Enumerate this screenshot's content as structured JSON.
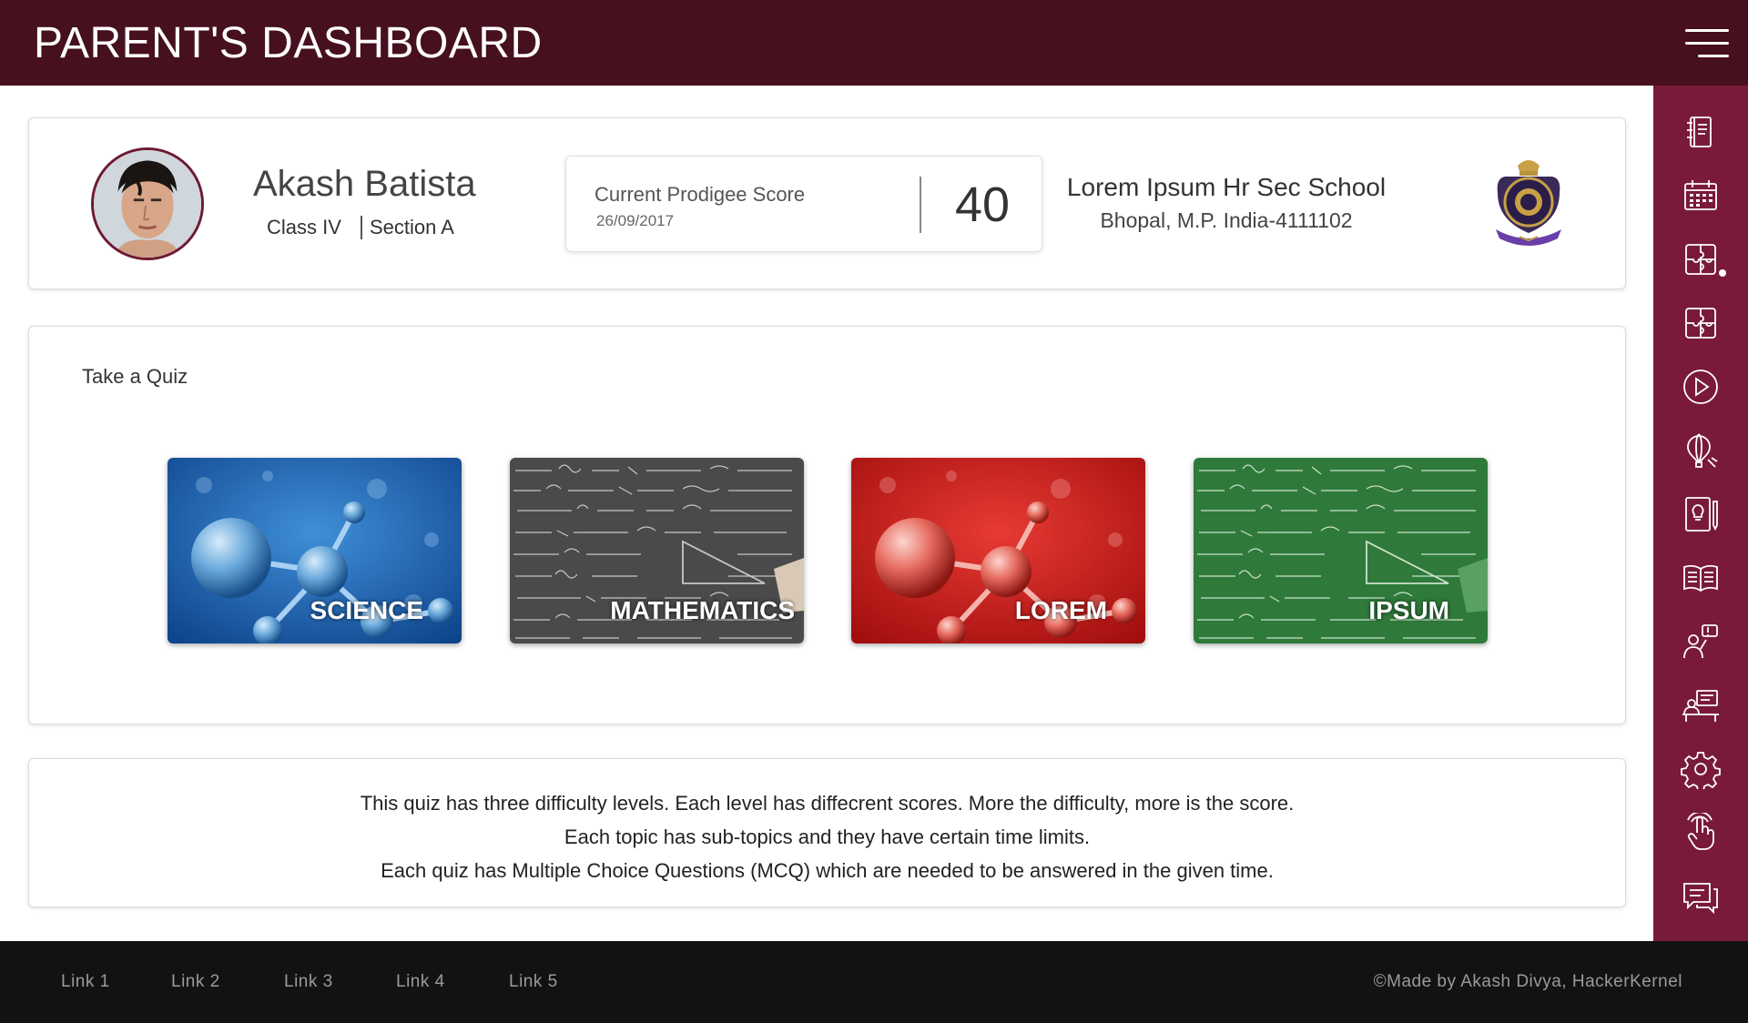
{
  "header": {
    "title": "PARENT'S DASHBOARD"
  },
  "profile": {
    "name": "Akash Batista",
    "class": "Class IV",
    "section": "Section A",
    "score_label": "Current Prodigee Score",
    "score_date": "26/09/2017",
    "score_value": "40",
    "school_name": "Lorem Ipsum Hr Sec School",
    "school_address": "Bhopal, M.P. India-4111102"
  },
  "quiz": {
    "heading": "Take a Quiz",
    "tiles": [
      {
        "label": "SCIENCE",
        "theme": "blue-molecules"
      },
      {
        "label": "MATHEMATICS",
        "theme": "grey-chalkboard"
      },
      {
        "label": "LOREM",
        "theme": "red-molecules"
      },
      {
        "label": "IPSUM",
        "theme": "green-chalkboard"
      }
    ]
  },
  "info": {
    "lines": [
      "This quiz has three difficulty levels. Each level has diffecrent scores. More the difficulty, more is the score.",
      "Each topic has sub-topics and they have certain time limits.",
      "Each quiz has Multiple Choice  Questions (MCQ) which are needed to be answered in the given time."
    ]
  },
  "sidebar": {
    "items": [
      "notebook-icon",
      "calendar-icon",
      "puzzle-icon",
      "puzzle-icon",
      "play-icon",
      "hot-air-balloon-icon",
      "idea-book-icon",
      "open-book-icon",
      "teacher-question-icon",
      "teacher-desk-icon",
      "gear-icon",
      "touch-hand-icon",
      "chat-icon"
    ]
  },
  "footer": {
    "links": [
      "Link 1",
      "Link 2",
      "Link 3",
      "Link 4",
      "Link 5"
    ],
    "copyright": "©Made by Akash Divya, HackerKernel"
  },
  "colors": {
    "header_bg": "#46101f",
    "sidebar_bg": "#7a1a39",
    "footer_bg": "#121212"
  }
}
